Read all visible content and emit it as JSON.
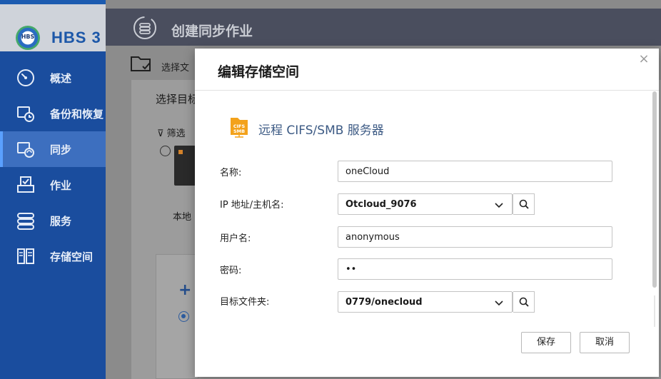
{
  "app": {
    "logo_text": "HBS",
    "title": "HBS 3",
    "nav": [
      {
        "label": "概述",
        "icon": "gauge-icon"
      },
      {
        "label": "备份和恢复",
        "icon": "backup-restore-icon"
      },
      {
        "label": "同步",
        "icon": "sync-icon",
        "active": true
      },
      {
        "label": "作业",
        "icon": "jobs-icon"
      },
      {
        "label": "服务",
        "icon": "services-icon"
      },
      {
        "label": "存储空间",
        "icon": "storage-space-icon"
      }
    ]
  },
  "wizard": {
    "title": "创建同步作业",
    "step_label": "选择文",
    "select_target_label": "选择目标",
    "filter_label": "筛选",
    "local_label": "本地"
  },
  "dialog": {
    "title": "编辑存储空间",
    "close_glyph": "×",
    "server_type": "远程 CIFS/SMB 服务器",
    "server_icon_text": "CIFS SMB",
    "fields": {
      "name": {
        "label": "名称:",
        "value": "oneCloud"
      },
      "ip": {
        "label": "IP 地址/主机名:",
        "value": "Otcloud_9076"
      },
      "username": {
        "label": "用户名:",
        "value": "anonymous"
      },
      "password": {
        "label": "密码:",
        "value": "••"
      },
      "target_folder": {
        "label": "目标文件夹:",
        "value": "0779/onecloud"
      }
    },
    "save_label": "保存",
    "cancel_label": "取消"
  },
  "colors": {
    "sidebar_bg": "#1a4d9e",
    "sidebar_active": "#3d6fbf",
    "wizard_header": "#4a4e5e",
    "server_title": "#3c5a84",
    "server_icon": "#f3a21b"
  }
}
